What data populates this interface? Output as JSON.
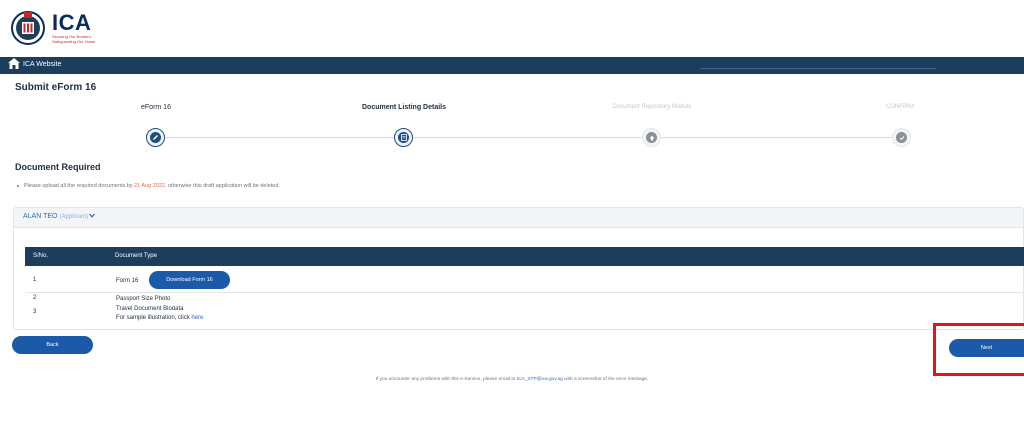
{
  "header": {
    "logo_text": "ICA",
    "logo_tagline": "Securing Our Borders, Safeguarding Our Home"
  },
  "navbar": {
    "home_label": "ICA Website"
  },
  "page": {
    "title": "Submit eForm 16"
  },
  "stepper": {
    "steps": [
      {
        "label": "eForm 16",
        "state": "done",
        "icon": "pencil-icon"
      },
      {
        "label": "Document Listing Details",
        "state": "active",
        "icon": "document-icon"
      },
      {
        "label": "Document Repository Module",
        "state": "inactive",
        "icon": "upload-icon"
      },
      {
        "label": "CONFIRM",
        "state": "inactive",
        "icon": "check-icon"
      }
    ]
  },
  "documents": {
    "section_title": "Document Required",
    "notice_prefix": "Please upload all the required documents by ",
    "notice_date": "21 Aug 2022",
    "notice_suffix": ", otherwise this draft application will be deleted.",
    "applicant_name": "ALAN TEO",
    "applicant_role": "(Applicant)",
    "columns": {
      "sno": "S/No.",
      "doc_type": "Document Type"
    },
    "rows": [
      {
        "sno": "1",
        "doc": "Form 16",
        "button": "Download Form 16"
      },
      {
        "sno": "2",
        "doc": "Passport Size Photo"
      },
      {
        "sno": "3",
        "doc": "Travel Document Biodata",
        "sub_prefix": "For sample illustration, click ",
        "sub_link": "here"
      }
    ]
  },
  "actions": {
    "back_label": "Back",
    "next_label": "Next"
  },
  "footer": {
    "prefix": "If you encounter any problems with this e-Service, please email to ",
    "email": "ICA_STP@ica.gov.sg",
    "suffix": " with a screenshot of the error message."
  },
  "colors": {
    "navbar": "#1c3d5c",
    "button": "#1b5aa8",
    "highlight": "#e0161e",
    "date": "#e46a4a"
  }
}
